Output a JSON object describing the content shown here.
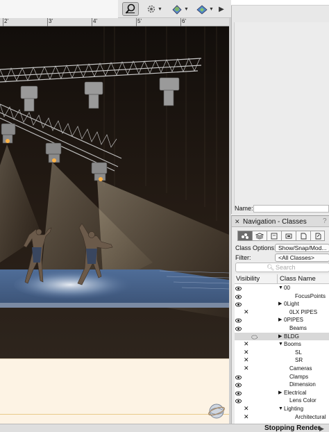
{
  "ruler": {
    "labels": [
      "2'",
      "3'",
      "4'",
      "5'",
      "6'"
    ]
  },
  "toolbar": {
    "zoom_icon": "magnifier-icon",
    "render_icon": "gear-render-icon",
    "view1_icon": "globe-view-icon",
    "view2_icon": "layers-view-icon",
    "more_icon": "triangle-right-icon"
  },
  "object_info": {
    "name_label": "Name:"
  },
  "navigation": {
    "title": "Navigation - Classes",
    "help": "?",
    "class_options_label": "Class Options:",
    "class_options_value": "Show/Snap/Mod...",
    "filter_label": "Filter:",
    "filter_value": "<All Classes>",
    "search_placeholder": "Search",
    "col_visibility": "Visibility",
    "col_class_name": "Class Name",
    "classes": [
      {
        "name": "00",
        "vis": "eye",
        "disc": "open",
        "indent": 0
      },
      {
        "name": "FocusPoints",
        "vis": "eye",
        "disc": "none",
        "indent": 2
      },
      {
        "name": "0Light",
        "vis": "eye",
        "disc": "closed",
        "indent": 0
      },
      {
        "name": "0LX PIPES",
        "vis": "x",
        "disc": "none",
        "indent": 1
      },
      {
        "name": "0PIPES",
        "vis": "eye",
        "disc": "closed",
        "indent": 0
      },
      {
        "name": "Beams",
        "vis": "eye",
        "disc": "none",
        "indent": 1
      },
      {
        "name": "BLDG",
        "vis": "half",
        "disc": "closed",
        "indent": 0,
        "selected": true
      },
      {
        "name": "Booms",
        "vis": "x",
        "disc": "open",
        "indent": 0
      },
      {
        "name": "SL",
        "vis": "x",
        "disc": "none",
        "indent": 2
      },
      {
        "name": "SR",
        "vis": "x",
        "disc": "none",
        "indent": 2
      },
      {
        "name": "Cameras",
        "vis": "x",
        "disc": "none",
        "indent": 1
      },
      {
        "name": "Clamps",
        "vis": "eye",
        "disc": "none",
        "indent": 1
      },
      {
        "name": "Dimension",
        "vis": "eye",
        "disc": "none",
        "indent": 1
      },
      {
        "name": "Electrical",
        "vis": "eye",
        "disc": "closed",
        "indent": 0
      },
      {
        "name": "Lens Color",
        "vis": "eye",
        "disc": "none",
        "indent": 1
      },
      {
        "name": "Lighting",
        "vis": "x",
        "disc": "open",
        "indent": 0
      },
      {
        "name": "Architectural",
        "vis": "x",
        "disc": "none",
        "indent": 2
      }
    ]
  },
  "status": {
    "text": "Stopping Render",
    "arrow": "▶"
  }
}
